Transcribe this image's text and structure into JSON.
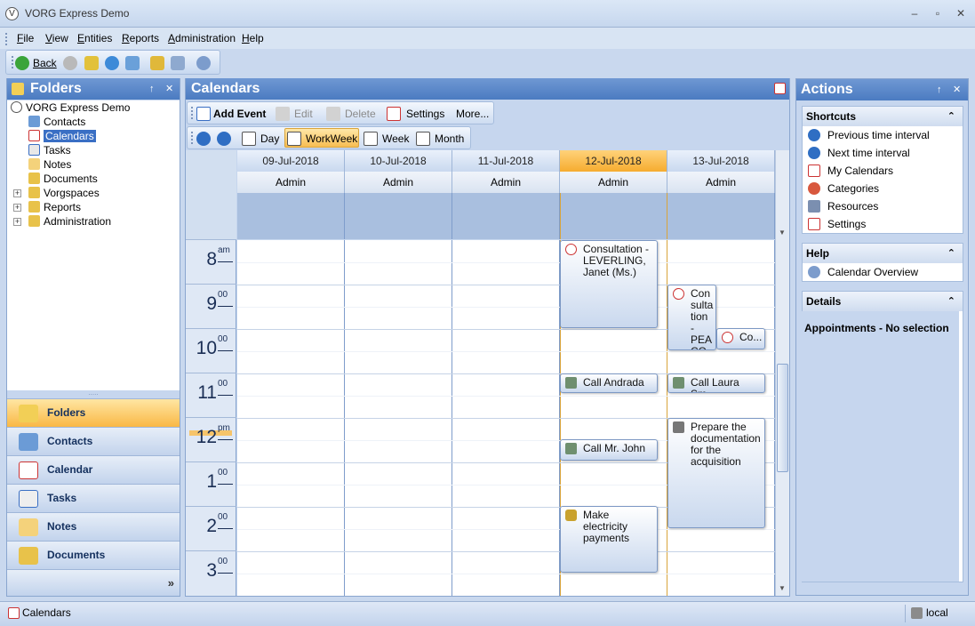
{
  "window": {
    "title": "VORG Express Demo",
    "minimize": "–",
    "maximize": "▫",
    "close": "✕"
  },
  "menu": [
    "File",
    "View",
    "Entities",
    "Reports",
    "Administration",
    "Help"
  ],
  "toolbar": {
    "back_label": "Back"
  },
  "folders": {
    "title": "Folders",
    "pin": "↑",
    "close": "✕",
    "root": "VORG Express Demo",
    "items": [
      "Contacts",
      "Calendars",
      "Tasks",
      "Notes",
      "Documents",
      "Vorgspaces",
      "Reports",
      "Administration"
    ],
    "selected": "Calendars"
  },
  "nav": {
    "items": [
      "Folders",
      "Contacts",
      "Calendar",
      "Tasks",
      "Notes",
      "Documents"
    ],
    "active": "Folders",
    "more": "»"
  },
  "calendar": {
    "title": "Calendars",
    "toolbar1": {
      "add": "Add Event",
      "edit": "Edit",
      "delete": "Delete",
      "settings": "Settings",
      "more": "More..."
    },
    "toolbar2": {
      "day": "Day",
      "workweek": "WorkWeek",
      "week": "Week",
      "month": "Month"
    },
    "days": [
      "09-Jul-2018",
      "10-Jul-2018",
      "11-Jul-2018",
      "12-Jul-2018",
      "13-Jul-2018"
    ],
    "today": "12-Jul-2018",
    "resource": "Admin",
    "hours": [
      {
        "h": "8",
        "s": "am"
      },
      {
        "h": "9",
        "s": "00"
      },
      {
        "h": "10",
        "s": "00"
      },
      {
        "h": "11",
        "s": "00"
      },
      {
        "h": "12",
        "s": "pm"
      },
      {
        "h": "1",
        "s": "00"
      },
      {
        "h": "2",
        "s": "00"
      },
      {
        "h": "3",
        "s": "00"
      }
    ],
    "appointments": [
      {
        "text": "Consultation - LEVERLING, Janet (Ms.)",
        "icon": "consultation-icon"
      },
      {
        "text": "Call Andrada",
        "icon": "phone-icon"
      },
      {
        "text": "Call Mr. John -...",
        "icon": "phone-icon"
      },
      {
        "text": "Make electricity payments",
        "icon": "money-bag-icon"
      },
      {
        "text": "Con sulta tion - PEA CO...",
        "icon": "consultation-icon"
      },
      {
        "text": "Co...",
        "icon": "consultation-icon"
      },
      {
        "text": "Call Laura Sm...",
        "icon": "phone-icon"
      },
      {
        "text": "Prepare the documentation for the acquisition",
        "icon": "task-icon"
      }
    ]
  },
  "actions": {
    "title": "Actions",
    "shortcuts": {
      "title": "Shortcuts",
      "items": [
        "Previous time interval",
        "Next time interval",
        "My Calendars",
        "Categories",
        "Resources",
        "Settings"
      ]
    },
    "help": {
      "title": "Help",
      "items": [
        "Calendar Overview"
      ]
    },
    "details": {
      "title": "Details",
      "text": "Appointments - No selection"
    }
  },
  "status": {
    "left": "Calendars",
    "right": "local"
  },
  "colors": {
    "header_blue": "#4b7bc1",
    "today_orange": "#f6ac2f",
    "selection_blue": "#3a6fc4"
  }
}
